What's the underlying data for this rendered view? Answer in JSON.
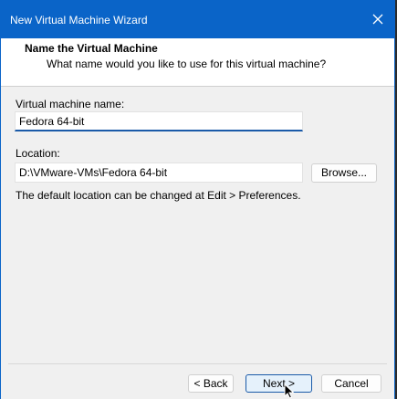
{
  "window": {
    "title": "New Virtual Machine Wizard"
  },
  "header": {
    "title": "Name the Virtual Machine",
    "subtitle": "What name would you like to use for this virtual machine?"
  },
  "form": {
    "vm_name_label": "Virtual machine name:",
    "vm_name_value": "Fedora 64-bit",
    "location_label": "Location:",
    "location_value": "D:\\VMware-VMs\\Fedora 64-bit",
    "browse_label": "Browse...",
    "hint": "The default location can be changed at Edit > Preferences."
  },
  "footer": {
    "back_label": "< Back",
    "next_label": "Next >",
    "cancel_label": "Cancel"
  },
  "icons": {
    "close": "close-icon",
    "cursor": "mouse-pointer-icon"
  },
  "colors": {
    "titlebar": "#0a64c8",
    "focus_accent": "#1a5aa8"
  }
}
